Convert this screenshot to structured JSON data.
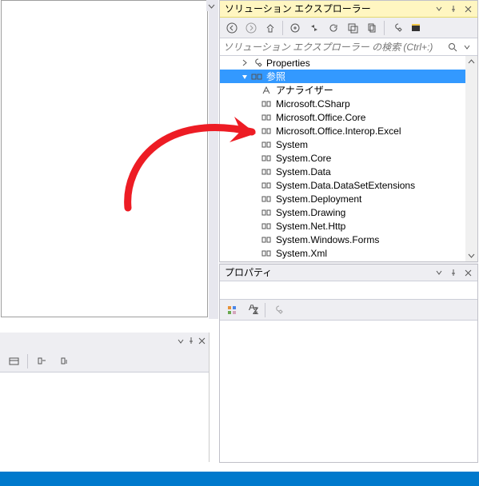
{
  "solution_explorer": {
    "title": "ソリューション エクスプローラー",
    "search_placeholder": "ソリューション エクスプローラー の検索 (Ctrl+:)",
    "tree": {
      "properties_label": "Properties",
      "references_label": "参照",
      "references": [
        "アナライザー",
        "Microsoft.CSharp",
        "Microsoft.Office.Core",
        "Microsoft.Office.Interop.Excel",
        "System",
        "System.Core",
        "System.Data",
        "System.Data.DataSetExtensions",
        "System.Deployment",
        "System.Drawing",
        "System.Net.Http",
        "System.Windows.Forms",
        "System.Xml"
      ]
    }
  },
  "properties_panel": {
    "title": "プロパティ"
  }
}
